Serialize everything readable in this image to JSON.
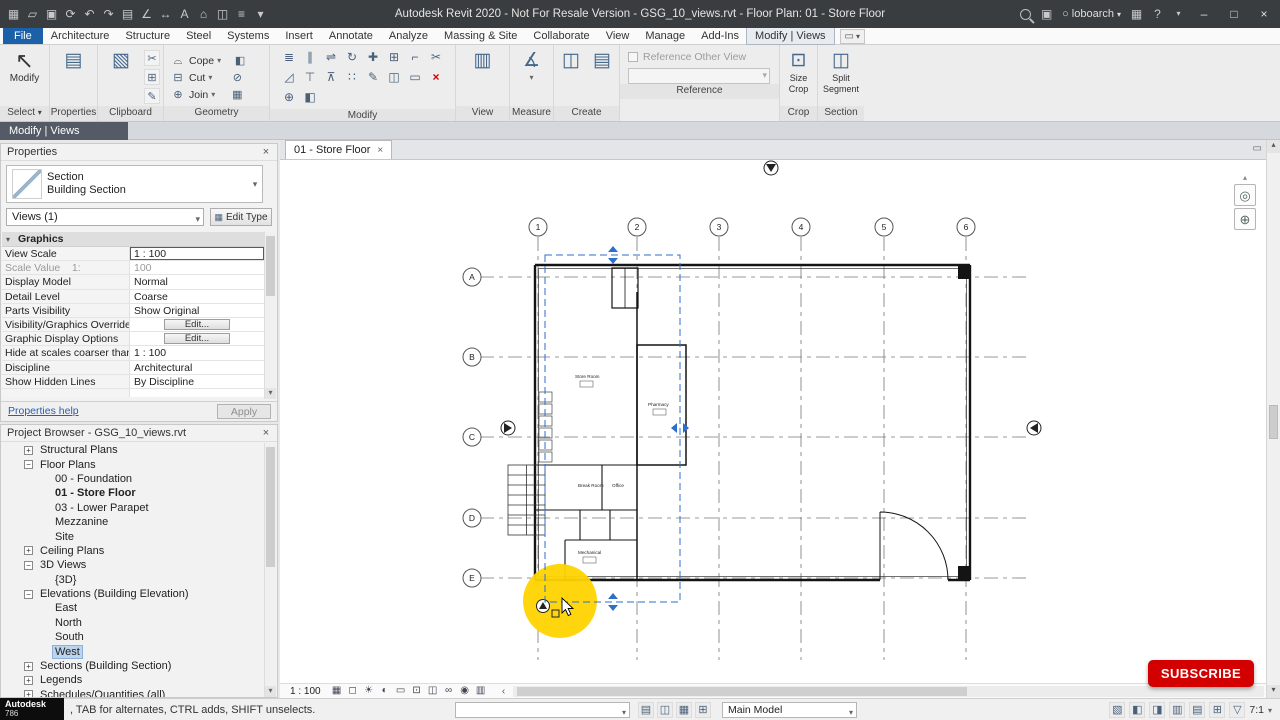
{
  "title_bar": {
    "title": "Autodesk Revit 2020 - Not For Resale Version - GSG_10_views.rvt - Floor Plan: 01 - Store Floor",
    "username": "loboarch"
  },
  "ribbon": {
    "tabs": [
      "File",
      "Architecture",
      "Structure",
      "Steel",
      "Systems",
      "Insert",
      "Annotate",
      "Analyze",
      "Massing & Site",
      "Collaborate",
      "View",
      "Manage",
      "Add-Ins",
      "Modify | Views"
    ],
    "panel_labels": [
      "Select",
      "Properties",
      "Clipboard",
      "Geometry",
      "Modify",
      "View",
      "Measure",
      "Create",
      "Reference",
      "Crop",
      "Section"
    ],
    "modify_button": "Modify",
    "geometry_buttons": [
      "Cope",
      "Cut",
      "Join"
    ],
    "reference_checkbox": "Reference Other View",
    "crop_button": "Size Crop",
    "section_button": "Split Segment"
  },
  "mode_bar": {
    "label": "Modify | Views"
  },
  "properties": {
    "header": "Properties",
    "type_family": "Section",
    "type_name": "Building Section",
    "selector": "Views (1)",
    "edit_type": "Edit Type",
    "group": "Graphics",
    "rows": [
      {
        "label": "View Scale",
        "value": "1 : 100"
      },
      {
        "label": "Scale Value    1:",
        "value": "100"
      },
      {
        "label": "Display Model",
        "value": "Normal"
      },
      {
        "label": "Detail Level",
        "value": "Coarse"
      },
      {
        "label": "Parts Visibility",
        "value": "Show Original"
      },
      {
        "label": "Visibility/Graphics Overrides",
        "value": "Edit..."
      },
      {
        "label": "Graphic Display Options",
        "value": "Edit..."
      },
      {
        "label": "Hide at scales coarser than",
        "value": "1 : 100"
      },
      {
        "label": "Discipline",
        "value": "Architectural"
      },
      {
        "label": "Show Hidden Lines",
        "value": "By Discipline"
      }
    ],
    "help": "Properties help",
    "apply": "Apply"
  },
  "project_browser": {
    "header": "Project Browser - GSG_10_views.rvt",
    "items": [
      {
        "label": "Structural Plans"
      },
      {
        "label": "Floor Plans"
      },
      {
        "label": "00 - Foundation"
      },
      {
        "label": "01 - Store Floor"
      },
      {
        "label": "03 - Lower Parapet"
      },
      {
        "label": "Mezzanine"
      },
      {
        "label": "Site"
      },
      {
        "label": "Ceiling Plans"
      },
      {
        "label": "3D Views"
      },
      {
        "label": "{3D}"
      },
      {
        "label": "Elevations (Building Elevation)"
      },
      {
        "label": "East"
      },
      {
        "label": "North"
      },
      {
        "label": "South"
      },
      {
        "label": "West"
      },
      {
        "label": "Sections (Building Section)"
      },
      {
        "label": "Legends"
      },
      {
        "label": "Schedules/Quantities (all)"
      }
    ]
  },
  "canvas": {
    "tab": "01 - Store Floor",
    "scale": "1 : 100",
    "cols": [
      "1",
      "2",
      "3",
      "4",
      "5",
      "6"
    ],
    "rows": [
      "A",
      "B",
      "C",
      "D",
      "E"
    ],
    "rooms": [
      "Store Room",
      "Pharmacy",
      "Break Room",
      "Office",
      "Mechanical"
    ]
  },
  "status_bar": {
    "hint": ", TAB for alternates, CTRL adds, SHIFT unselects.",
    "main_model": "Main Model",
    "count": "7:1",
    "watermark_line1": "Autodesk",
    "watermark_line2": "786"
  },
  "subscribe": {
    "label": "SUBSCRIBE"
  },
  "icons": {
    "caret": "▾",
    "caret_up": "▴",
    "app_menu": "▦",
    "open": "▱",
    "save": "▣",
    "sync": "⟳",
    "undo": "↶",
    "redo": "↷",
    "print": "▤",
    "measure": "∠",
    "dimension": "↔",
    "text": "A",
    "view3d": "⌂",
    "section": "◫",
    "thin_lines": "≡",
    "min": "–",
    "max": "□",
    "close": "×",
    "help": "?",
    "user": "○",
    "store": "▦",
    "comm": "▣",
    "modify_arrow": "↖",
    "properties_btn": "▤",
    "paste": "▧",
    "cut_small": "✂",
    "copy_small": "⊞",
    "match_small": "✎",
    "cope": "⌓",
    "cut_geo": "⊟",
    "join": "⊕",
    "geo_extra": [
      "◧",
      "⊘",
      "▦"
    ],
    "modify_grid": [
      "≣",
      "∥",
      "⇌",
      "↻",
      "✚",
      "⊞",
      "⌐",
      "✂",
      "◿",
      "⊤",
      "⊼",
      "∷",
      "✎",
      "◫",
      "▭",
      "×",
      "⊕",
      "◧"
    ],
    "view_big": "▥",
    "measure_big": "∡",
    "create1": "◫",
    "create2": "▤",
    "crop_big": "⊡",
    "section_big": "◫",
    "tab_extra": "▭",
    "nav_wheel": "◎",
    "nav_zoom": "⊕",
    "chev_left": "‹",
    "vcb": [
      "▦",
      "◻",
      "☀",
      "◐",
      "▭",
      "⊡",
      "◫",
      "∞",
      "◉",
      "▥"
    ],
    "sleft": [
      "▤",
      "◫",
      "▦",
      "⊞"
    ],
    "sright": [
      "▧",
      "◧",
      "◨",
      "▥",
      "▤",
      "⊞"
    ],
    "funnel": "▽",
    "plus": "+",
    "minus": "−",
    "edit_type": "▦"
  }
}
